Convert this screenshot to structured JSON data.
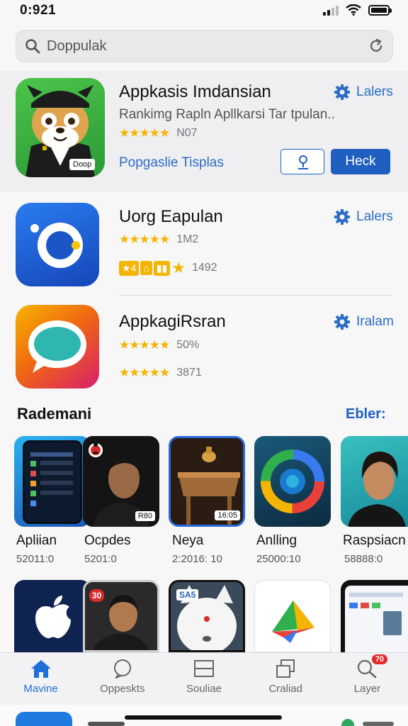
{
  "status_bar": {
    "time": "0:921"
  },
  "search": {
    "value": "Doppulak"
  },
  "featured": {
    "title": "Appkasis Imdansian",
    "subtitle": "Rankimg Rapln Apllkarsi Tar tpulan..",
    "stars": "★★★★★",
    "rating_count": "N07",
    "link": "Popgaslie Tisplas",
    "action": "Lalers",
    "button_primary": "Heck",
    "icon_badge": "Doop"
  },
  "apps": [
    {
      "title": "Uorg Eapulan",
      "stars": "★★★★★",
      "meta": "1M2",
      "extra": "1492",
      "action": "Lalers"
    },
    {
      "title": "AppkagiRsran",
      "stars": "★★★★★",
      "meta": "50%",
      "extra": "3871",
      "action": "Iralam"
    }
  ],
  "section": {
    "title": "Rademani",
    "see_all": "Ebler:"
  },
  "tiles": [
    {
      "label": "Apliian",
      "meta": "52011:0",
      "badge": ""
    },
    {
      "label": "Ocpdes",
      "meta": "5201:0",
      "badge": "R80"
    },
    {
      "label": "Neya",
      "meta": "2:2016: 10",
      "badge": "16:05"
    },
    {
      "label": "Anlling",
      "meta": "25000:10",
      "badge": ""
    },
    {
      "label": "Raspsiacn",
      "meta": "58888:0",
      "badge": ""
    }
  ],
  "tiles_row2_badges": [
    "",
    "30",
    "SA5",
    "",
    ""
  ],
  "tabs": [
    {
      "label": "Mavine",
      "icon": "home-icon"
    },
    {
      "label": "Oppeskts",
      "icon": "heart-icon"
    },
    {
      "label": "Souliae",
      "icon": "panel-icon"
    },
    {
      "label": "Craliad",
      "icon": "layers-icon"
    },
    {
      "label": "Layer",
      "icon": "search-icon",
      "badge": "70"
    }
  ],
  "colors": {
    "accent": "#1f5fbf",
    "star": "#f5b400",
    "active_tab": "#1f6fd6"
  }
}
